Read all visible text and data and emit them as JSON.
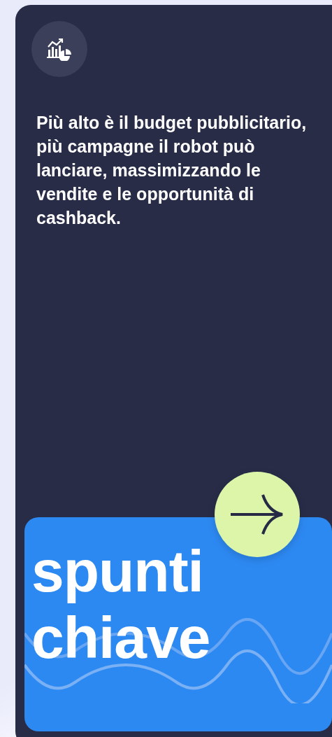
{
  "card": {
    "description": "Più alto è il budget pubblicitario, più campagne il robot può lanciare, massimizzando le vendite e le opportunità di cashback.",
    "panel": {
      "title_lines": [
        "spunti",
        "chiave"
      ]
    }
  }
}
